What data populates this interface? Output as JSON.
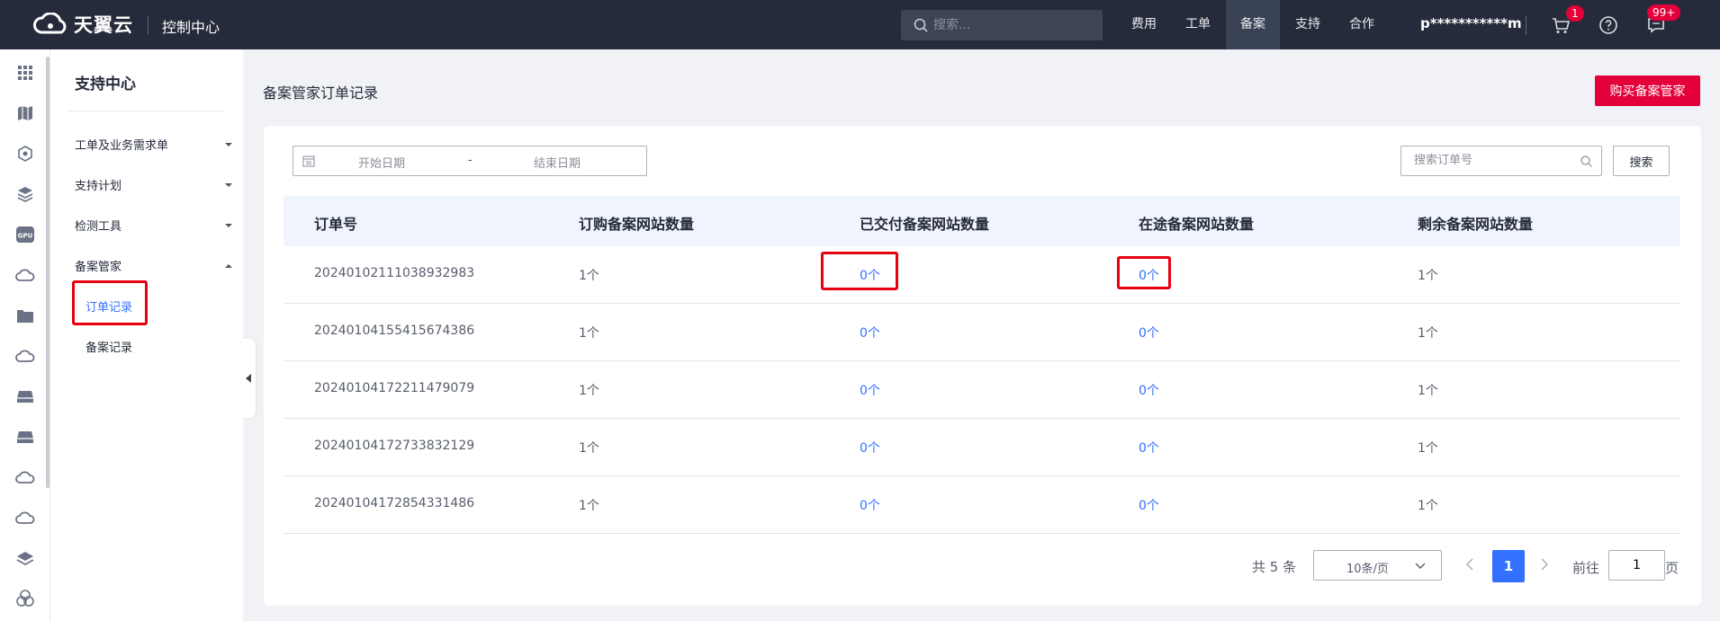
{
  "topbar": {
    "brand": "天翼云",
    "console": "控制中心",
    "search_placeholder": "搜索...",
    "nav": [
      "费用",
      "工单",
      "备案",
      "支持",
      "合作"
    ],
    "active_nav": "备案",
    "user": "p***********m",
    "cart_badge": "1",
    "msg_badge": "99+"
  },
  "rail": {
    "icons": [
      "grid-icon",
      "map-icon",
      "cube-network-icon",
      "layers-icon",
      "gpu-icon",
      "cloud-icon",
      "folder-icon",
      "cloud-icon",
      "server-icon",
      "server-icon",
      "cloud-icon",
      "cloud-icon",
      "stack-icon",
      "clover-icon"
    ],
    "gpu_label": "GPU"
  },
  "sidebar": {
    "title": "支持中心",
    "groups": [
      {
        "label": "工单及业务需求单",
        "expanded": false
      },
      {
        "label": "支持计划",
        "expanded": false
      },
      {
        "label": "检测工具",
        "expanded": false
      },
      {
        "label": "备案管家",
        "expanded": true
      }
    ],
    "subitems": [
      {
        "label": "订单记录",
        "active": true
      },
      {
        "label": "备案记录",
        "active": false
      }
    ]
  },
  "main": {
    "page_title": "备案管家订单记录",
    "buy_button": "购买备案管家",
    "date_start_placeholder": "开始日期",
    "date_separator": "-",
    "date_end_placeholder": "结束日期",
    "order_search_placeholder": "搜索订单号",
    "search_button": "搜索"
  },
  "table": {
    "columns": [
      "订单号",
      "订购备案网站数量",
      "已交付备案网站数量",
      "在途备案网站数量",
      "剩余备案网站数量"
    ],
    "rows": [
      [
        "20240102111038932983",
        "1个",
        "0个",
        "0个",
        "1个"
      ],
      [
        "20240104155415674386",
        "1个",
        "0个",
        "0个",
        "1个"
      ],
      [
        "20240104172211479079",
        "1个",
        "0个",
        "0个",
        "1个"
      ],
      [
        "20240104172733832129",
        "1个",
        "0个",
        "0个",
        "1个"
      ],
      [
        "20240104172854331486",
        "1个",
        "0个",
        "0个",
        "1个"
      ]
    ]
  },
  "pagination": {
    "total": "共 5 条",
    "page_size": "10条/页",
    "current_page": "1",
    "goto_label": "前往",
    "goto_value": "1",
    "goto_suffix": "页"
  },
  "colors": {
    "topbar_bg": "#252b3a",
    "accent_red": "#e4003a",
    "link_blue": "#3370ff",
    "highlight_box": "#e60012"
  }
}
